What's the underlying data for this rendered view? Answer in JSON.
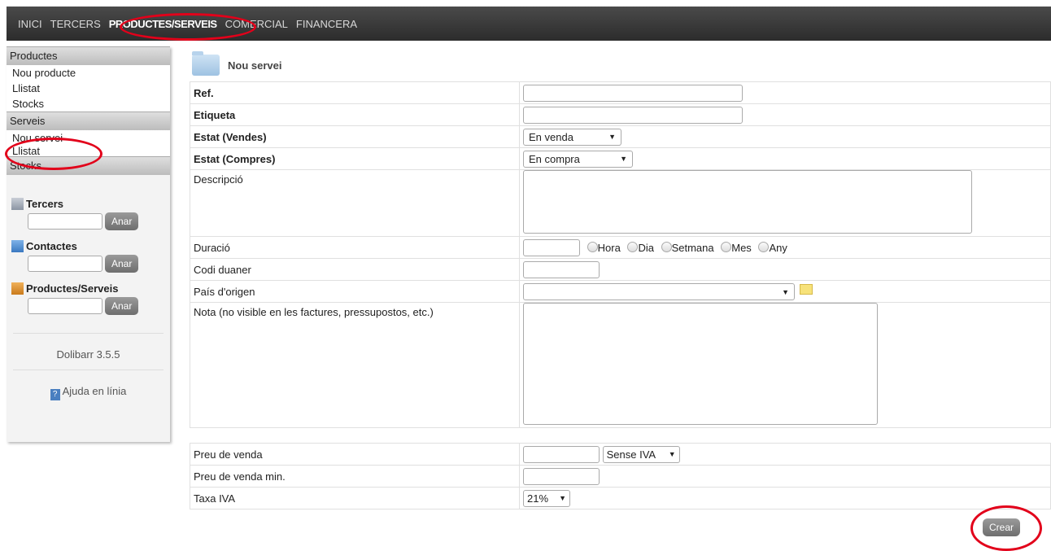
{
  "topmenu": {
    "items": [
      "INICI",
      "TERCERS",
      "PRODUCTES/SERVEIS",
      "COMERCIAL",
      "FINANCERA"
    ],
    "active": "PRODUCTES/SERVEIS"
  },
  "sidebar": {
    "productes": {
      "header": "Productes",
      "items": [
        "Nou producte",
        "Llistat",
        "Stocks"
      ]
    },
    "serveis": {
      "header": "Serveis",
      "items": [
        "Nou servei",
        "Llistat"
      ]
    },
    "stocks_header": "Stocks",
    "search": [
      {
        "label": "Tercers",
        "button": "Anar",
        "icon": "building-icon"
      },
      {
        "label": "Contactes",
        "button": "Anar",
        "icon": "contact-card-icon"
      },
      {
        "label": "Productes/Serveis",
        "button": "Anar",
        "icon": "product-box-icon"
      }
    ],
    "version": "Dolibarr 3.5.5",
    "help": "Ajuda en línia"
  },
  "page": {
    "title": "Nou servei",
    "fields": {
      "ref": "Ref.",
      "etiqueta": "Etiqueta",
      "estat_vendes": "Estat (Vendes)",
      "estat_vendes_value": "En venda",
      "estat_compres": "Estat (Compres)",
      "estat_compres_value": "En compra",
      "descripcio": "Descripció",
      "duracio": "Duració",
      "duracio_units": [
        "Hora",
        "Dia",
        "Setmana",
        "Mes",
        "Any"
      ],
      "codi_duaner": "Codi duaner",
      "pais_origen": "País d'origen",
      "pais_origen_value": "",
      "nota": "Nota (no visible en les factures, pressupostos, etc.)",
      "preu_venda": "Preu de venda",
      "preu_venda_base": "Sense IVA",
      "preu_venda_min": "Preu de venda min.",
      "taxa_iva": "Taxa IVA",
      "taxa_iva_value": "21%"
    },
    "submit": "Crear"
  },
  "colors": {
    "topbar": "#2c2c2c",
    "highlight_ring": "#e2001a",
    "button": "#7a7a7a"
  }
}
